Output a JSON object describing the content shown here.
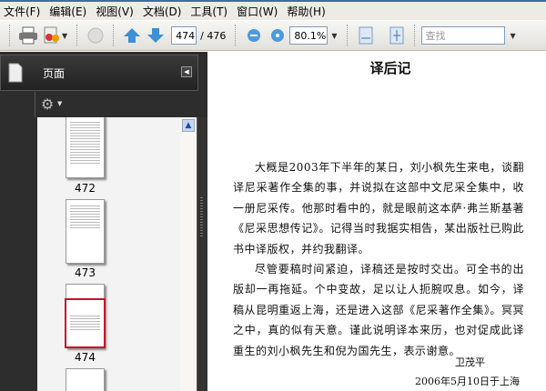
{
  "menu": [
    "文件(F)",
    "编辑(E)",
    "视图(V)",
    "文档(D)",
    "工具(T)",
    "窗口(W)",
    "帮助(H)"
  ],
  "toolbar": {
    "current_page": "474",
    "total_pages": "/ 476",
    "zoom": "80.1%",
    "search_placeholder": "查找"
  },
  "panel": {
    "title": "页面",
    "thumbnails": [
      {
        "label": "472"
      },
      {
        "label": "473"
      },
      {
        "label": "474",
        "selected": true
      },
      {
        "label": ""
      }
    ]
  },
  "document": {
    "title": "译后记",
    "paragraphs": [
      "大概是2003年下半年的某日，刘小枫先生来电，谈翻译尼采著作全集的事，并说拟在这部中文尼采全集中，收一册尼采传。他那时看中的，就是眼前这本萨·弗兰斯基著《尼采思想传记》。记得当时我据实相告，某出版社已购此书中译版权，并约我翻译。",
      "尽管要稿时间紧迫，译稿还是按时交出。可全书的出版却一再拖延。个中变故，足以让人扼腕叹息。如今，译稿从昆明重返上海，还是进入这部《尼采著作全集》。冥冥之中，真的似有天意。谨此说明译本来历，也对促成此译重生的刘小枫先生和倪为国先生，表示谢意。"
    ],
    "signature": "卫茂平",
    "date": "2006年5月10日于上海"
  },
  "colors": {
    "selected_thumb": "#c8102e",
    "panel_bg": "#2d2d2d"
  }
}
